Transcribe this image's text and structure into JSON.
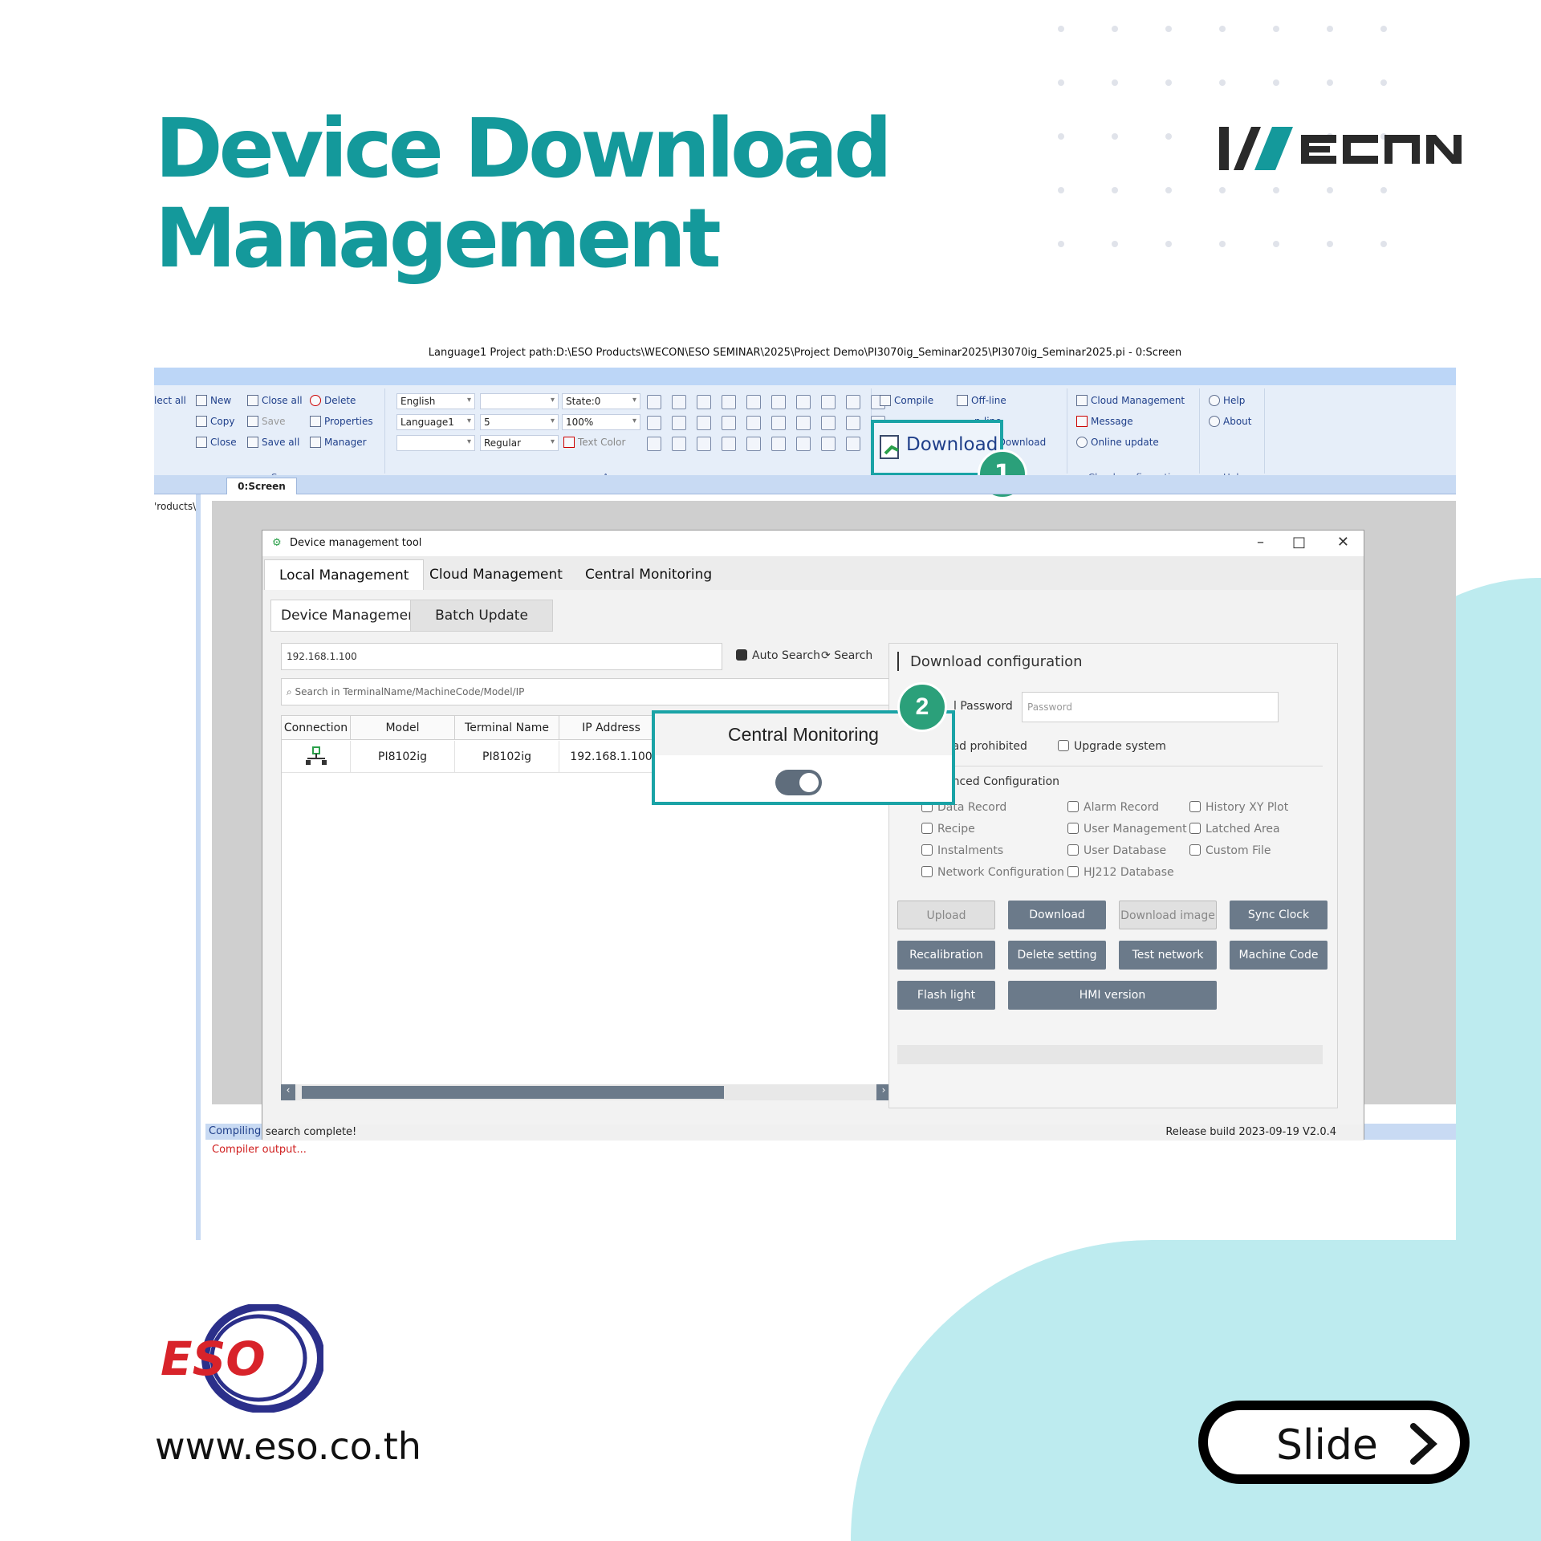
{
  "page": {
    "title_line1": "Device Download",
    "title_line2": "Management",
    "url": "www.eso.co.th",
    "slide_label": "Slide",
    "brand_logo": "WECON",
    "company_logo": "ESO",
    "colors": {
      "teal": "#14999b",
      "blob": "#bdebef",
      "badge": "#2ba07a"
    }
  },
  "app": {
    "window_title": "Language1   Project path:D:\\ESO Products\\WECON\\ESO SEMINAR\\2025\\Project Demo\\PI3070ig_Seminar2025\\PI3070ig_Seminar2025.pi   - 0:Screen",
    "ribbon": {
      "select_all": "lect all",
      "screen": {
        "new": "New",
        "copy": "Copy",
        "close": "Close",
        "close_all": "Close all",
        "save": "Save",
        "save_all": "Save all",
        "delete": "Delete",
        "properties": "Properties",
        "manager": "Manager",
        "label": "Screen"
      },
      "appearance": {
        "lang_dd": "English",
        "lang_dd2": "Language1",
        "dd_blank": "",
        "size": "5",
        "state": "State:0",
        "zoom": "100%",
        "font_style": "Regular",
        "text_color": "Text Color",
        "label": "Appearance"
      },
      "download": {
        "compile": "Compile",
        "offline": "Off-line",
        "online": "n-line",
        "download": "Download",
        "disk_download": "Disk Download"
      },
      "cloud": {
        "cloud_management": "Cloud Management",
        "message": "Message",
        "online_update": "Online update",
        "label": "Cloud configuration"
      },
      "help": {
        "help": "Help",
        "about": "About",
        "label": "Help"
      }
    },
    "tab_screen": "0:Screen",
    "left_path": "'roducts\\",
    "status_compiling": "Compiling",
    "compiler_output": "Compiler output..."
  },
  "dialog": {
    "title": "Device management tool",
    "main_tabs": [
      "Local Management",
      "Cloud Management",
      "Central Monitoring"
    ],
    "sub_tabs": [
      "Device Management",
      "Batch Update"
    ],
    "ip_value": "192.168.1.100",
    "auto_search": "Auto Search",
    "search": "Search",
    "search_placeholder": "Search in TerminalName/MachineCode/Model/IP",
    "table": {
      "headers": [
        "Connection",
        "Model",
        "Terminal Name",
        "IP Address"
      ],
      "row": {
        "model": "PI8102ig",
        "terminal": "PI8102ig",
        "ip": "192.168.1.100"
      }
    },
    "config": {
      "title": "Download configuration",
      "password_label": "l Password",
      "password_placeholder": "Password",
      "upload_prohibited": "oad prohibited",
      "upgrade_system": "Upgrade system",
      "advanced": "anced Configuration",
      "options": [
        "Data Record",
        "Alarm Record",
        "History XY Plot",
        "Recipe",
        "User Management",
        "Latched Area",
        "Instalments",
        "User Database",
        "Custom File",
        "Network Configuration",
        "HJ212 Database"
      ],
      "buttons": [
        "Upload",
        "Download",
        "Download image",
        "Sync Clock",
        "Recalibration",
        "Delete setting",
        "Test network",
        "Machine Code",
        "Flash light",
        "HMI version"
      ]
    },
    "status_left": "search complete!",
    "status_right": "Release build 2023-09-19 V2.0.4"
  },
  "callouts": {
    "badge1": "1",
    "badge2": "2",
    "popup_title": "Central Monitoring",
    "popup_toggle_on": true
  }
}
